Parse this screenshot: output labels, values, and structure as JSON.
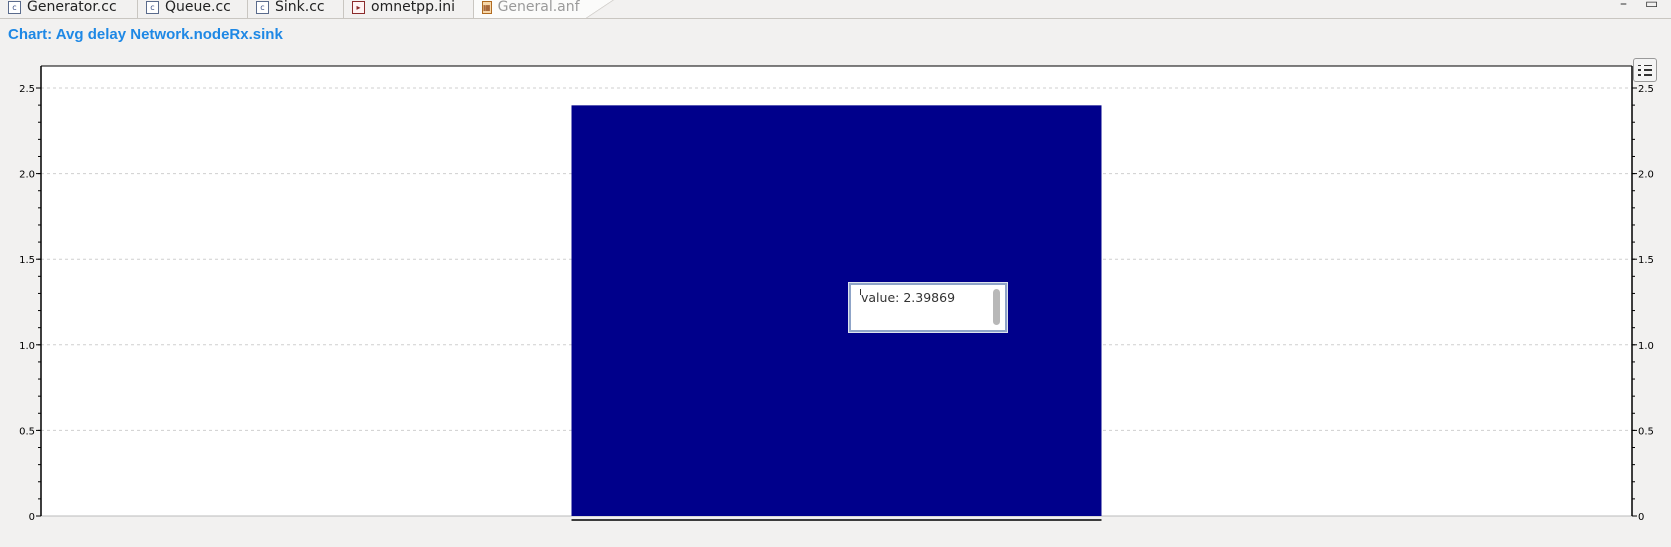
{
  "tabs": [
    {
      "label": "Generator.cc",
      "icon": "cpp-file-icon",
      "glyph": "c"
    },
    {
      "label": "Queue.cc",
      "icon": "cpp-file-icon",
      "glyph": "c"
    },
    {
      "label": "Sink.cc",
      "icon": "cpp-file-icon",
      "glyph": "c"
    },
    {
      "label": "omnetpp.ini",
      "icon": "ini-file-icon",
      "glyph": "▸"
    },
    {
      "label": "General.anf",
      "icon": "analysis-file-icon",
      "glyph": "▦",
      "close": "✕"
    }
  ],
  "window": {
    "minimize": "–",
    "maximize": "▭"
  },
  "chart": {
    "title": "Chart: Avg delay Network.nodeRx.sink"
  },
  "tooltip": {
    "text": "value: 2.39869"
  },
  "icons": {
    "legend": "legend-list-icon"
  },
  "colors": {
    "bar": "#00008b",
    "title": "#1e88e5",
    "grid": "#cfcfcf"
  },
  "chart_data": {
    "type": "bar",
    "categories": [
      ""
    ],
    "series": [
      {
        "values": [
          2.39869
        ]
      }
    ],
    "ylim": [
      0,
      2.5
    ],
    "yticks": [
      "0",
      "0.5",
      "1.0",
      "1.5",
      "2.0",
      "2.5"
    ],
    "grid": true,
    "dual_y_axis": true
  }
}
